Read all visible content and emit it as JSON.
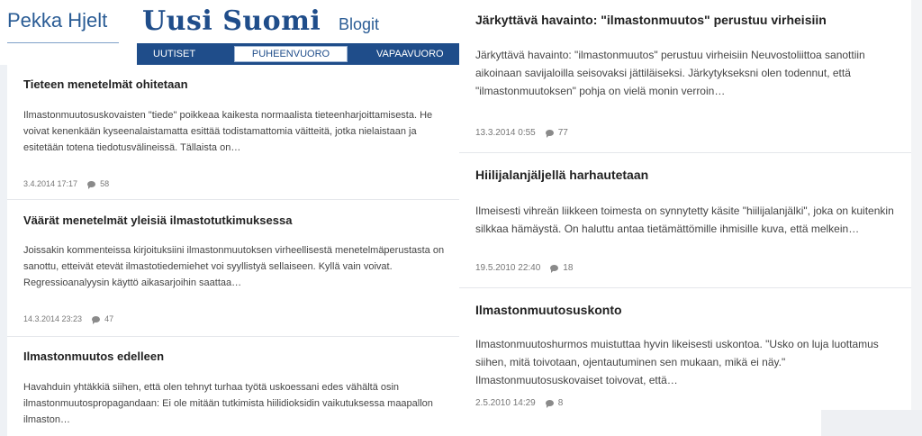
{
  "blog": {
    "author": "Pekka Hjelt",
    "logo_main": "Uusi Suomi",
    "logo_sub": "Blogit"
  },
  "nav": {
    "items": [
      {
        "label": "UUTISET"
      },
      {
        "label": "PUHEENVUORO"
      },
      {
        "label": "VAPAAVUORO"
      }
    ]
  },
  "posts_left": [
    {
      "title": "Tieteen menetelmät ohitetaan",
      "excerpt": "Ilmastonmuutosuskovaisten \"tiede\" poikkeaa kaikesta normaalista tieteenharjoittamisesta. He voivat kenenkään kyseenalaistamatta esittää todistamattomia väitteitä, jotka nielaistaan ja esitetään totena tiedotusvälineissä. Tällaista on…",
      "date": "3.4.2014 17:17",
      "comments": "58"
    },
    {
      "title": "Väärät menetelmät yleisiä ilmastotutkimuksessa",
      "excerpt": "Joissakin kommenteissa kirjoituksiini ilmastonmuutoksen virheellisestä  menetelmäperustasta on sanottu, etteivät etevät ilmastotiedemiehet voi syyllistyä sellaiseen. Kyllä vain voivat. Regressioanalyysin käyttö aikasarjoihin saattaa…",
      "date": "14.3.2014 23:23",
      "comments": "47"
    },
    {
      "title": "Ilmastonmuutos edelleen",
      "excerpt": "Havahduin yhtäkkiä siihen, että olen tehnyt turhaa työtä uskoessani edes vähältä osin ilmastonmuutospropagandaan: Ei ole mitään tutkimista hiilidioksidin vaikutuksessa maapallon ilmaston…",
      "date": "",
      "comments": ""
    }
  ],
  "posts_right": [
    {
      "title": "Järkyttävä havainto: \"ilmastonmuutos\" perustuu virheisiin",
      "excerpt": "Järkyttävä havainto:  \"ilmastonmuutos\" perustuu virheisiin Neuvostoliittoa sanottiin aikoinaan savijaloilla seisovaksi jättiläiseksi. Järkytykseksni olen todennut, että \"ilmastonmuutoksen\" pohja on vielä monin verroin…",
      "date": "13.3.2014 0:55",
      "comments": "77"
    },
    {
      "title": "Hiilijalanjäljellä harhautetaan",
      "excerpt": "Ilmeisesti vihreän liikkeen toimesta on synnytetty käsite \"hiilijalanjälki\", joka on kuitenkin silkkaa hämäystä. On haluttu antaa tietämättömille ihmisille kuva, että melkein…",
      "date": "19.5.2010 22:40",
      "comments": "18"
    },
    {
      "title": "Ilmastonmuutosuskonto",
      "excerpt": "Ilmastonmuutoshurmos muistuttaa hyvin likeisesti uskontoa. \"Usko on luja luottamus siihen, mitä toivotaan, ojentautuminen sen mukaan, mikä ei näy.\"  Ilmastonmuutosuskovaiset toivovat, että…",
      "date": "2.5.2010 14:29",
      "comments": "8"
    }
  ]
}
